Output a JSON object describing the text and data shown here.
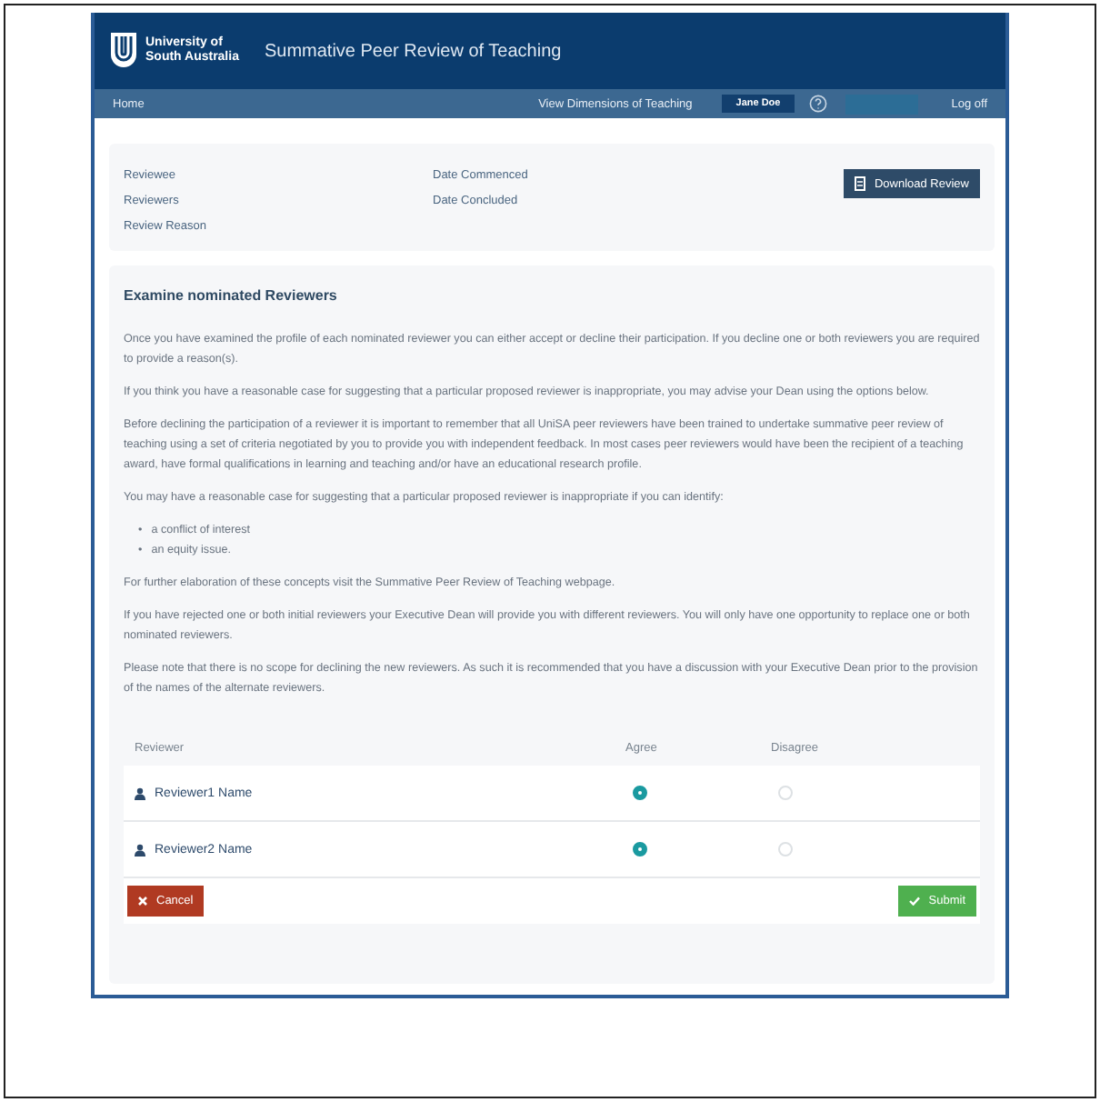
{
  "header": {
    "logo_text": [
      "University of",
      "South Australia"
    ],
    "title": "Summative Peer Review of Teaching"
  },
  "nav": {
    "home": "Home",
    "dimensions": "View Dimensions of Teaching",
    "user": "Jane Doe",
    "logoff": "Log off"
  },
  "info": {
    "left": [
      "Reviewee",
      "Reviewers",
      "Review Reason"
    ],
    "middle": [
      "Date Commenced",
      "Date Concluded"
    ],
    "download_button": "Download Review"
  },
  "section": {
    "title": "Examine nominated Reviewers",
    "paragraphs_before": [
      "Once you have examined the profile of each nominated reviewer you can either accept or decline their participation. If you decline one or both reviewers you are required to provide a reason(s).",
      "If you think you have a reasonable case for suggesting that a particular proposed reviewer is inappropriate, you may advise your Dean using the options below.",
      "Before declining the participation of a reviewer it is important to remember that all UniSA peer reviewers have been trained to undertake summative peer review of teaching using a set of criteria negotiated by you to provide you with independent feedback. In most cases peer reviewers would have been the recipient of a teaching award, have formal qualifications in learning and teaching and/or have an educational research profile.",
      "You may have a reasonable case for suggesting that a particular proposed reviewer is inappropriate if you can identify:"
    ],
    "bullets": [
      {
        "marker": "•",
        "text": "a conflict of interest"
      },
      {
        "marker": "•",
        "text": "an equity issue."
      }
    ],
    "paragraphs_after": [
      "For further elaboration of these concepts visit the Summative Peer Review of Teaching webpage.",
      "If you have rejected one or both initial reviewers your Executive Dean will provide you with different reviewers. You will only have one opportunity to replace one or both nominated reviewers.",
      "Please note that there is no scope for declining the new reviewers. As such it is recommended that you have a discussion with your Executive Dean prior to the provision of the names of the alternate reviewers."
    ]
  },
  "table": {
    "columns": [
      "Reviewer",
      "Agree",
      "Disagree"
    ],
    "rows": [
      {
        "name": "Reviewer1 Name",
        "options": [
          {
            "selected": true
          },
          {
            "selected": false
          }
        ]
      },
      {
        "name": "Reviewer2 Name",
        "options": [
          {
            "selected": true
          },
          {
            "selected": false
          }
        ]
      }
    ]
  },
  "buttons": {
    "cancel": "Cancel",
    "submit": "Submit"
  }
}
